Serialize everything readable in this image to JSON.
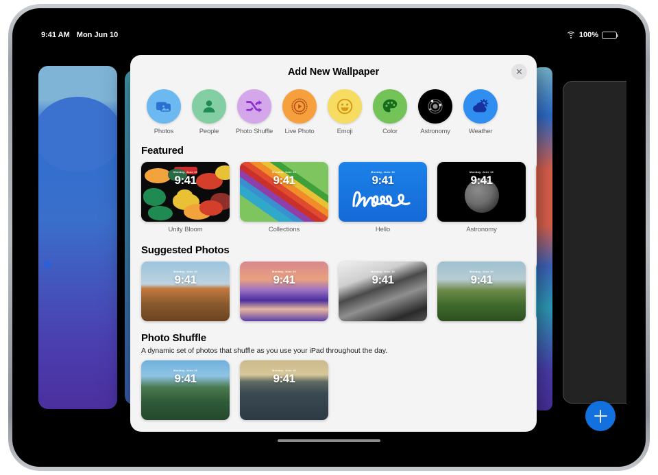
{
  "status_bar": {
    "time": "9:41 AM",
    "date": "Mon Jun 10",
    "wifi_icon": "wifi-icon",
    "battery_percent": "100%",
    "battery_icon": "battery-icon"
  },
  "sheet": {
    "title": "Add New Wallpaper",
    "close_label": "✕"
  },
  "categories": [
    {
      "label": "Photos",
      "icon": "photos-icon",
      "bg": "#6cb8f0",
      "fg": "#2a6fd0"
    },
    {
      "label": "People",
      "icon": "people-icon",
      "bg": "#83cfa3",
      "fg": "#1e8a52"
    },
    {
      "label": "Photo Shuffle",
      "icon": "shuffle-icon",
      "bg": "#d4a6ea",
      "fg": "#8c2fd0"
    },
    {
      "label": "Live Photo",
      "icon": "live-photo-icon",
      "bg": "#f5a03c",
      "fg": "#b8541a"
    },
    {
      "label": "Emoji",
      "icon": "emoji-icon",
      "bg": "#f7dc62",
      "fg": "#d79a17"
    },
    {
      "label": "Color",
      "icon": "color-palette-icon",
      "bg": "#73c358",
      "fg": "#166b1b"
    },
    {
      "label": "Astronomy",
      "icon": "astronomy-icon",
      "bg": "#000000",
      "fg": "#b9b9b9"
    },
    {
      "label": "Weather",
      "icon": "weather-icon",
      "bg": "#2f8ef0",
      "fg": "#17329e"
    }
  ],
  "sections": [
    {
      "title": "Featured",
      "subtitle": "",
      "items": [
        {
          "caption": "Unity Bloom",
          "time": "9:41",
          "date": "Monday, June 10",
          "art": "unity"
        },
        {
          "caption": "Collections",
          "time": "9:41",
          "date": "Monday, June 10",
          "art": "collections"
        },
        {
          "caption": "Hello",
          "time": "9:41",
          "date": "Monday, June 10",
          "art": "hello"
        },
        {
          "caption": "Astronomy",
          "time": "9:41",
          "date": "Monday, June 10",
          "art": "astronomy"
        }
      ],
      "partial_color": "#e2654f"
    },
    {
      "title": "Suggested Photos",
      "subtitle": "",
      "items": [
        {
          "caption": "",
          "time": "9:41",
          "date": "Monday, June 10",
          "art": "photo-field"
        },
        {
          "caption": "",
          "time": "9:41",
          "date": "Monday, June 10",
          "art": "photo-canyon"
        },
        {
          "caption": "",
          "time": "9:41",
          "date": "Monday, June 10",
          "art": "photo-coast-bw"
        },
        {
          "caption": "",
          "time": "9:41",
          "date": "Monday, June 10",
          "art": "photo-sheep"
        }
      ],
      "partial_color": "#2f9dbf"
    },
    {
      "title": "Photo Shuffle",
      "subtitle": "A dynamic set of photos that shuffle as you use your iPad throughout the day.",
      "items": [
        {
          "caption": "",
          "time": "9:41",
          "date": "Monday, June 10",
          "art": "photo-mountains"
        },
        {
          "caption": "",
          "time": "9:41",
          "date": "Monday, June 10",
          "art": "photo-seastacks"
        }
      ],
      "partial_color": ""
    }
  ],
  "add_button": {
    "label": "+",
    "icon": "plus-icon",
    "color": "#1271df"
  }
}
